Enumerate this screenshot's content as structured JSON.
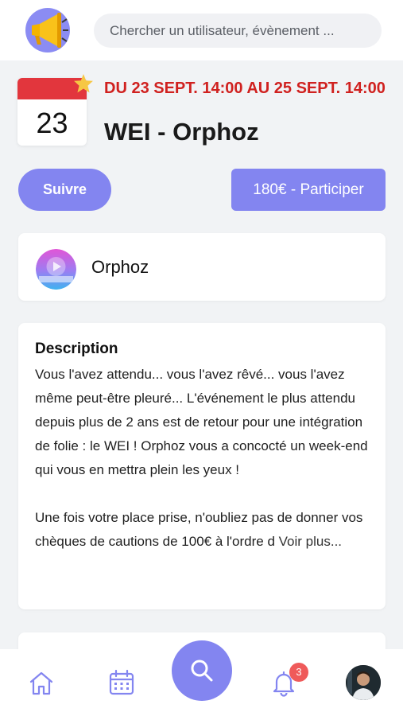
{
  "header": {
    "search_placeholder": "Chercher un utilisateur, évènement ..."
  },
  "event": {
    "calendar_day": "23",
    "date_range": "DU 23 SEPT. 14:00 AU 25 SEPT. 14:00",
    "title": "WEI - Orphoz",
    "follow_label": "Suivre",
    "participate_label": "180€ - Participer"
  },
  "organizer": {
    "name": "Orphoz"
  },
  "description": {
    "title": "Description",
    "text": "Vous l'avez attendu... vous l'avez rêvé... vous l'avez même peut-être pleuré... L'événement le plus attendu depuis plus de 2 ans est de retour pour une intégration de folie : le WEI ! Orphoz vous a concocté un week-end qui vous en mettra plein les yeux !\n\nUne fois votre place prise, n'oubliez pas de donner vos chèques de cautions de 100€ à l'ordre d",
    "see_more": "Voir plus..."
  },
  "bottom_nav": {
    "notification_count": "3",
    "icons": [
      "home-icon",
      "calendar-icon",
      "search-icon",
      "bell-icon",
      "profile-avatar"
    ]
  },
  "colors": {
    "accent": "#8385f0",
    "date_red": "#d0211f",
    "calendar_band": "#e2363d",
    "badge": "#ef5a5a"
  }
}
